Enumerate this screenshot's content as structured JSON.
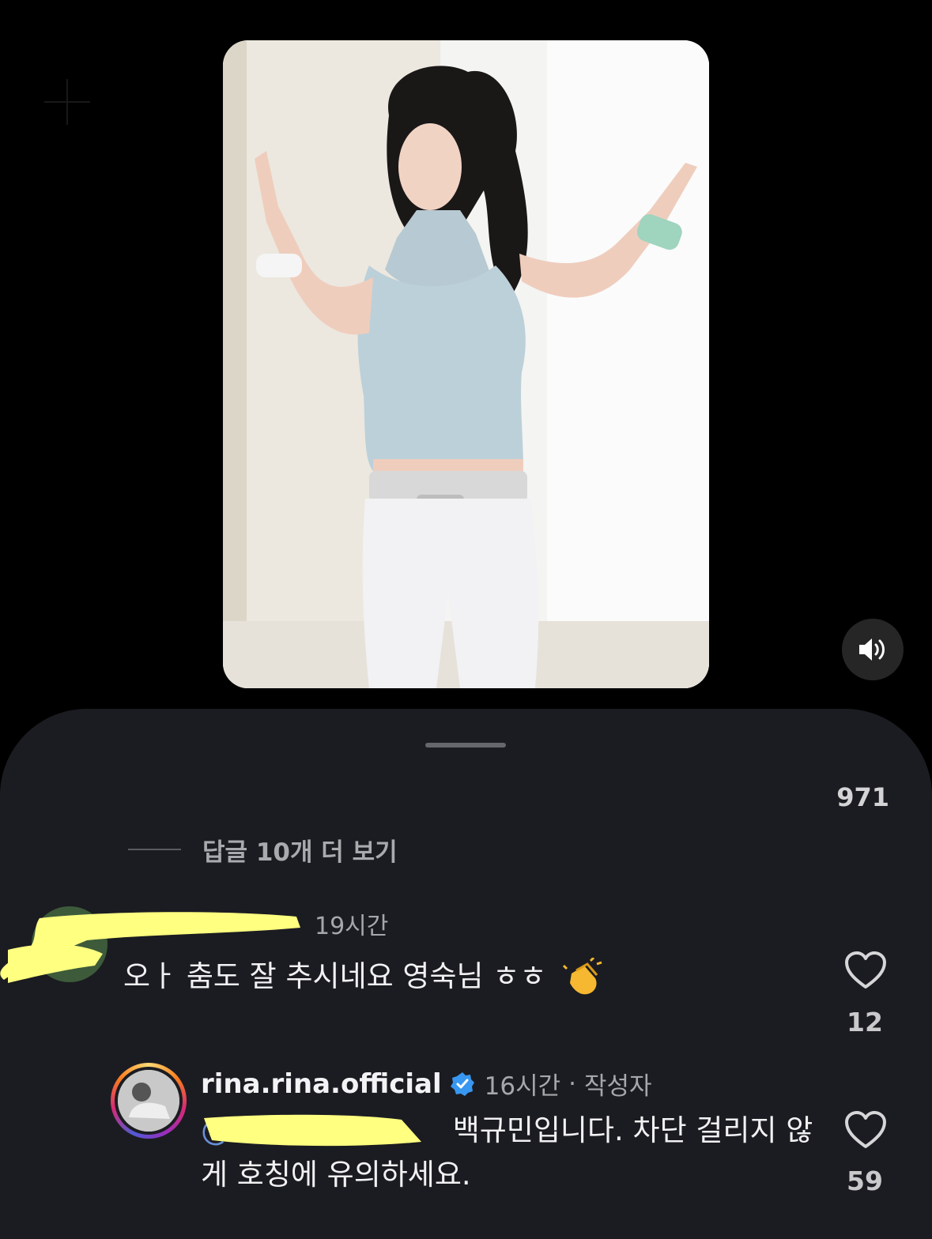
{
  "video": {
    "subject": "dancing woman video"
  },
  "sheet": {
    "comment_count": "971",
    "view_more_replies": "답글 10개 더 보기"
  },
  "comments": [
    {
      "username": "",
      "time": "19시간",
      "text": "오ㅏ 춤도 잘 추시네요 영숙님 ㅎㅎ",
      "emoji": "clapping-hands",
      "likes": "12"
    },
    {
      "username": "rina.rina.official",
      "verified": true,
      "time": "16시간",
      "separator": "·",
      "author_badge": "작성자",
      "mention": "@",
      "text": " 백규민입니다. 차단 걸리지 않게 호칭에 유의하세요.",
      "likes": "59"
    }
  ],
  "colors": {
    "sheet_bg": "#1b1c21",
    "verified": "#3897f0",
    "mention": "#6b8fd8",
    "redaction": "#ffff80"
  },
  "icons": [
    "plus-icon",
    "speaker-icon",
    "heart-icon",
    "verified-badge-icon",
    "clapping-hands-icon"
  ]
}
